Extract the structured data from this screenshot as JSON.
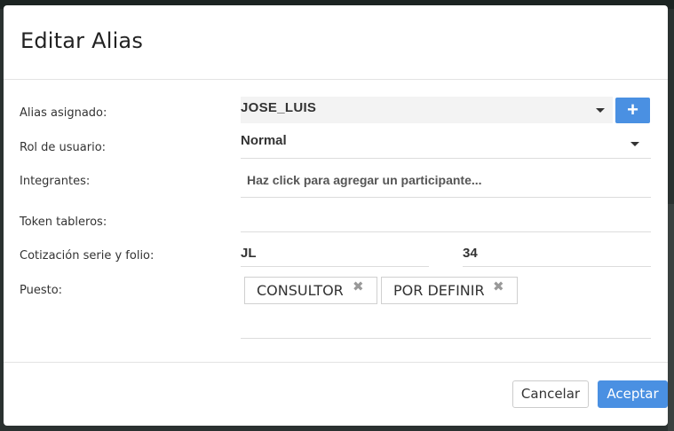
{
  "modal": {
    "title": "Editar Alias"
  },
  "form": {
    "alias": {
      "label": "Alias asignado:",
      "value": "JOSE_LUIS",
      "add_icon": "plus-icon",
      "add_label": "+"
    },
    "rol": {
      "label": "Rol de usuario:",
      "value": "Normal"
    },
    "integrantes": {
      "label": "Integrantes:",
      "placeholder": "Haz click para agregar un participante..."
    },
    "token": {
      "label": "Token tableros:",
      "value": ""
    },
    "cotizacion": {
      "label": "Cotización serie y folio:",
      "serie": "JL",
      "folio": "34"
    },
    "puesto": {
      "label": "Puesto:",
      "tags": [
        "CONSULTOR",
        "POR DEFINIR"
      ],
      "remove_glyph": "✖"
    }
  },
  "footer": {
    "cancel_label": "Cancelar",
    "ok_label": "Aceptar"
  },
  "colors": {
    "primary": "#4a90e2",
    "overlay": "#2a3130"
  }
}
